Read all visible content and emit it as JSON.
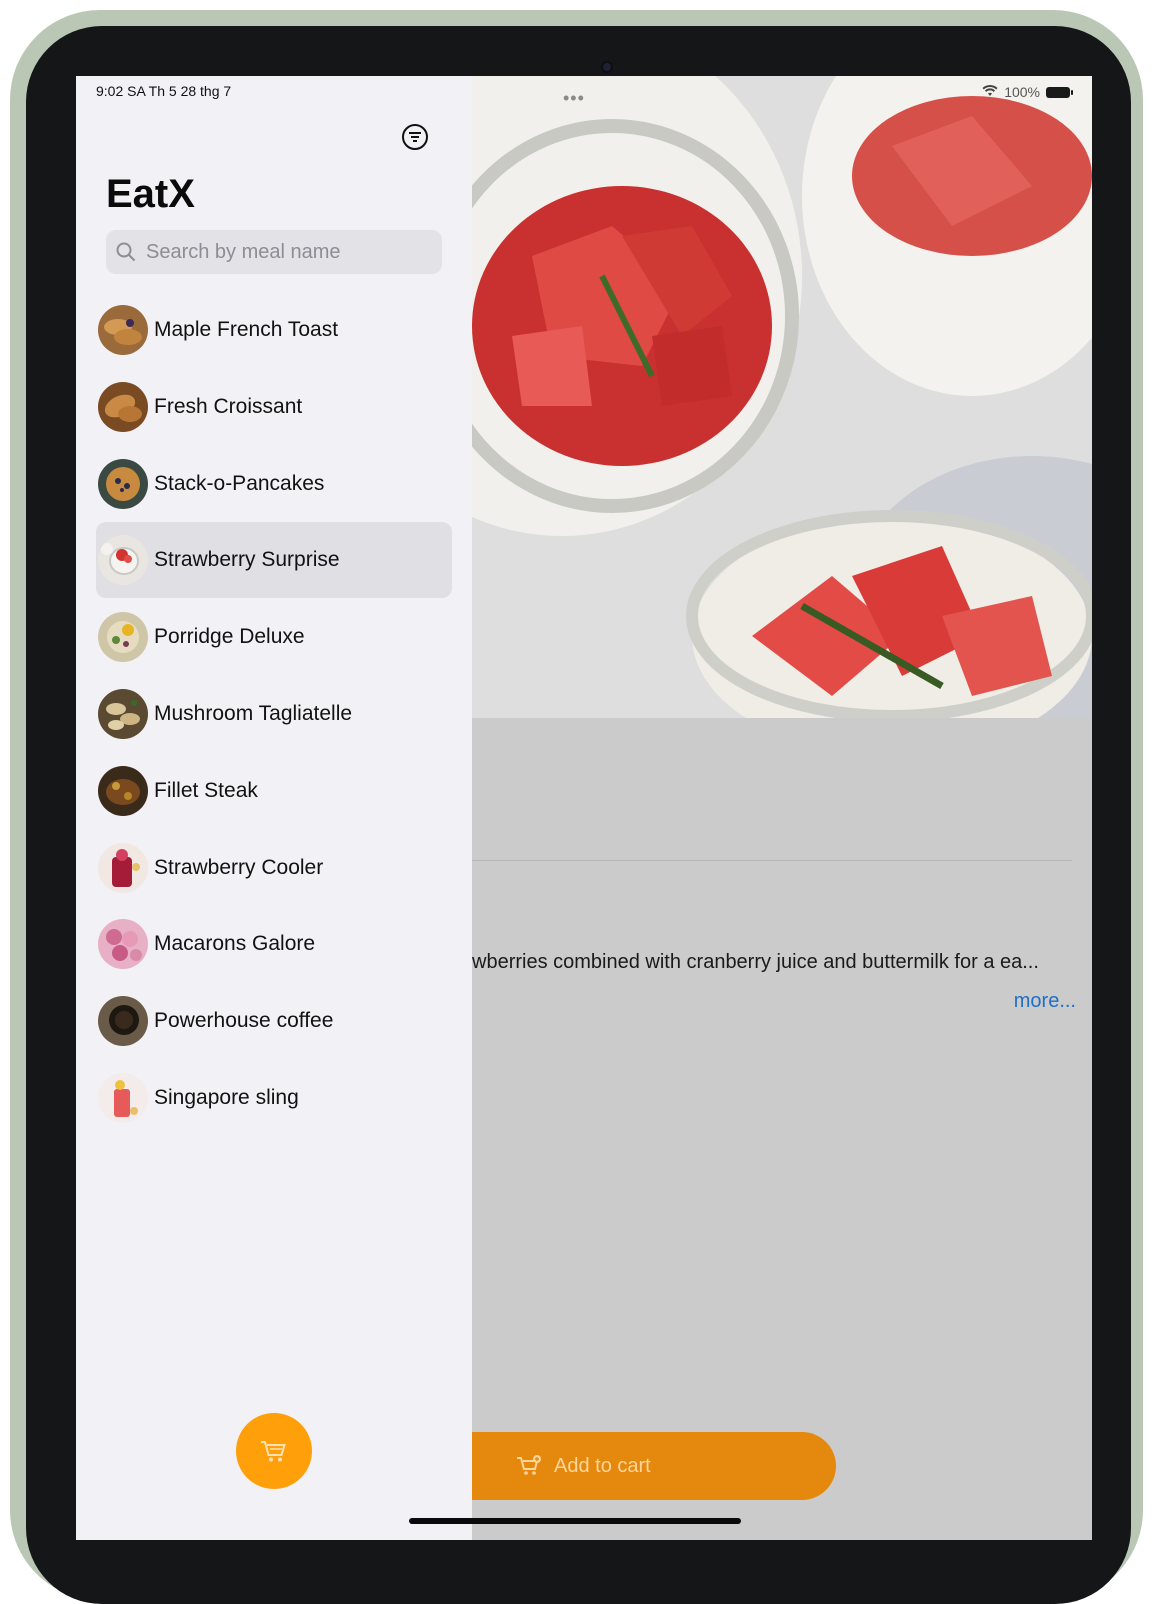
{
  "status_bar": {
    "time_date": "9:02 SA   Th 5 28 thg 7",
    "battery": "100%"
  },
  "app": {
    "title": "EatX"
  },
  "search": {
    "placeholder": "Search by meal name",
    "value": ""
  },
  "meals": [
    {
      "label": "Maple French Toast",
      "thumb_color": "#9a6a3a"
    },
    {
      "label": "Fresh Croissant",
      "thumb_color": "#a8703a"
    },
    {
      "label": "Stack-o-Pancakes",
      "thumb_color": "#6b4a2a"
    },
    {
      "label": "Strawberry Surprise",
      "thumb_color": "#e7dcd6",
      "selected": true
    },
    {
      "label": "Porridge Deluxe",
      "thumb_color": "#b7a870"
    },
    {
      "label": "Mushroom Tagliatelle",
      "thumb_color": "#8a7a5a"
    },
    {
      "label": "Fillet Steak",
      "thumb_color": "#5c3c20"
    },
    {
      "label": "Strawberry Cooler",
      "thumb_color": "#a31e3a"
    },
    {
      "label": "Macarons Galore",
      "thumb_color": "#d88aa8"
    },
    {
      "label": "Powerhouse coffee",
      "thumb_color": "#4a3a2a"
    },
    {
      "label": "Singapore sling",
      "thumb_color": "#e86060"
    }
  ],
  "detail": {
    "description": "wberries combined with cranberry juice and buttermilk for a ea...",
    "more_label": "more...",
    "add_to_cart_label": "Add to cart"
  },
  "colors": {
    "accent": "#ff9f0a",
    "link": "#1e6fc7",
    "sidebar_bg": "#f2f1f6"
  },
  "icons": {
    "filter": "filter-circle-icon",
    "search": "search-icon",
    "cart": "cart-icon",
    "add_cart": "cart-plus-icon"
  }
}
